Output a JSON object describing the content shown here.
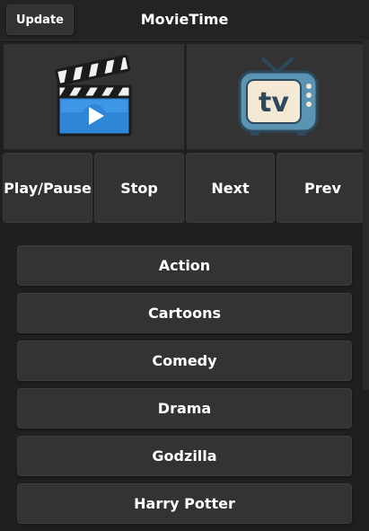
{
  "header": {
    "update_label": "Update",
    "title": "MovieTime"
  },
  "tiles": [
    {
      "name": "movies",
      "icon": "clapperboard-play-icon"
    },
    {
      "name": "tv",
      "icon": "tv-icon",
      "icon_text": "tv"
    }
  ],
  "controls": {
    "play_pause": "Play/Pause",
    "stop": "Stop",
    "next": "Next",
    "prev": "Prev"
  },
  "categories": [
    "Action",
    "Cartoons",
    "Comedy",
    "Drama",
    "Godzilla",
    "Harry Potter"
  ],
  "colors": {
    "background": "#1f1f1f",
    "button": "#333333",
    "text": "#ffffff",
    "clapper_blue": "#2f86d6",
    "tv_body": "#5b93b2",
    "tv_screen": "#f3e9d5"
  }
}
